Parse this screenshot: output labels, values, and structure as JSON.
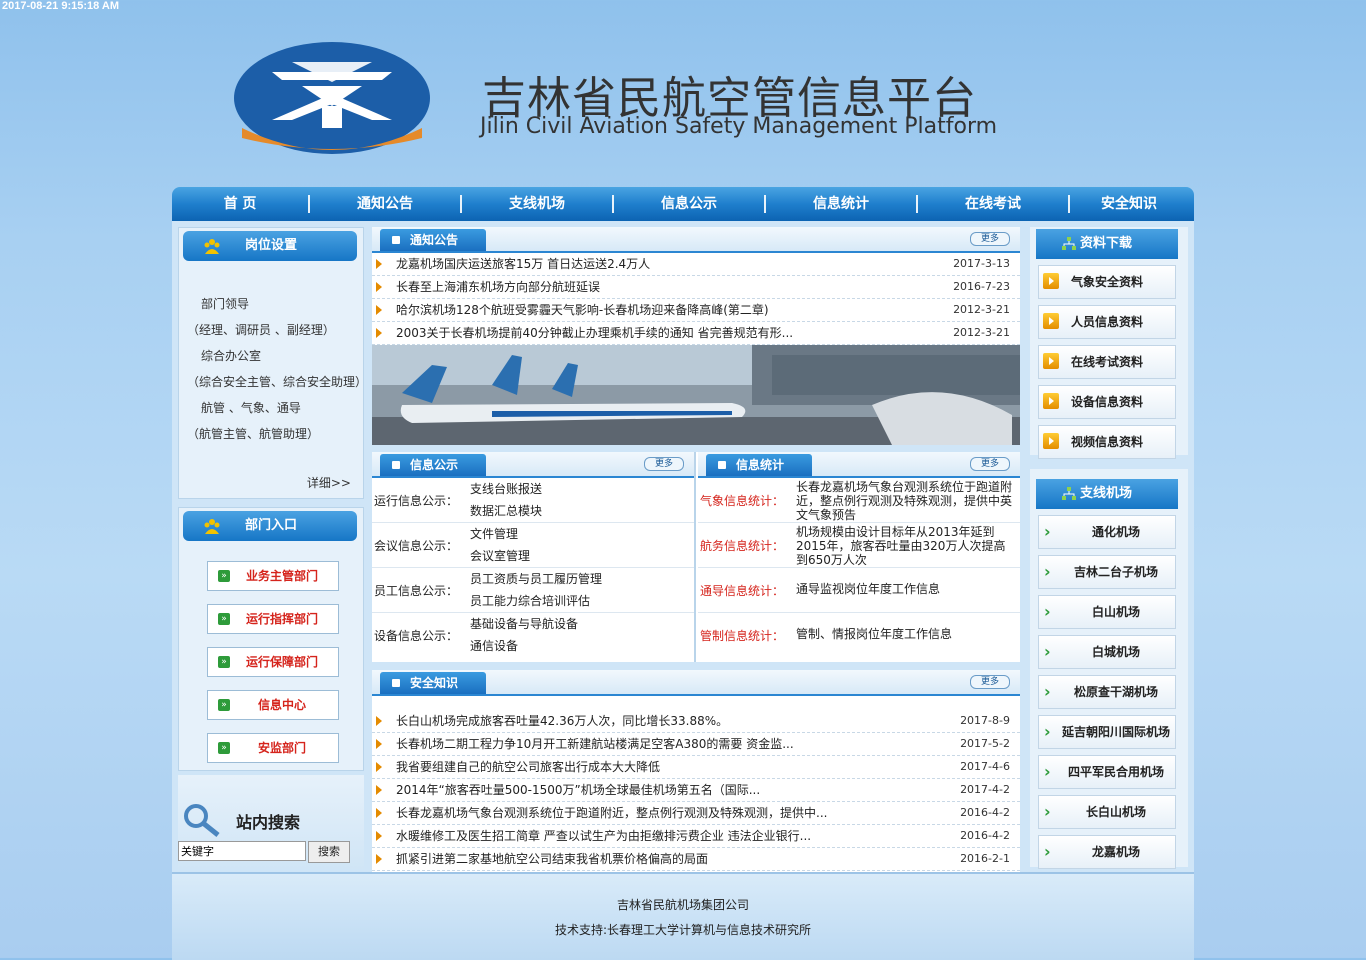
{
  "timestamp": "2017-08-21 9:15:18 AM",
  "header": {
    "title": "吉林省民航空管信息平台",
    "subtitle": "Jilin Civil Aviation Safety Management Platform"
  },
  "nav": [
    "首 页",
    "通知公告",
    "支线机场",
    "信息公示",
    "信息统计",
    "在线考试",
    "安全知识"
  ],
  "left": {
    "posts": {
      "title": "岗位设置",
      "lines": [
        "部门领导",
        "（经理、调研员 、副经理）",
        "综合办公室",
        "（综合安全主管、综合安全助理）",
        "航管 、气象、通导",
        "（航管主管、航管助理）"
      ],
      "more": "详细>>"
    },
    "dept": {
      "title": "部门入口",
      "buttons": [
        "业务主管部门",
        "运行指挥部门",
        "运行保障部门",
        "信息中心",
        "安监部门"
      ]
    },
    "search": {
      "title": "站内搜索",
      "value": "关键字",
      "button": "搜索"
    }
  },
  "notice": {
    "title": "通知公告",
    "more": "更多",
    "items": [
      {
        "title": "龙嘉机场国庆运送旅客15万 首日达运送2.4万人",
        "date": "2017-3-13"
      },
      {
        "title": "长春至上海浦东机场方向部分航班延误",
        "date": "2016-7-23"
      },
      {
        "title": "哈尔滨机场128个航班受雾霾天气影响-长春机场迎来备降高峰(第二章)",
        "date": "2012-3-21"
      },
      {
        "title": "2003关于长春机场提前40分钟截止办理乘机手续的通知 省完善规范有形...",
        "date": "2012-3-21"
      }
    ]
  },
  "info": {
    "title": "信息公示",
    "more": "更多",
    "rows": [
      {
        "cat": "运行信息公示：",
        "items": [
          "支线台账报送",
          "数据汇总模块"
        ]
      },
      {
        "cat": "会议信息公示：",
        "items": [
          "文件管理",
          "会议室管理"
        ]
      },
      {
        "cat": "员工信息公示：",
        "items": [
          "员工资质与员工履历管理",
          "员工能力综合培训评估"
        ]
      },
      {
        "cat": "设备信息公示：",
        "items": [
          "基础设备与导航设备",
          "通信设备"
        ]
      }
    ]
  },
  "stats": {
    "title": "信息统计",
    "more": "更多",
    "rows": [
      {
        "cat": "气象信息统计：",
        "text": "长春龙嘉机场气象台观测系统位于跑道附近，整点例行观测及特殊观测，提供中英文气象预告"
      },
      {
        "cat": "航务信息统计：",
        "text": "机场规模由设计目标年从2013年延到2015年，旅客吞吐量由320万人次提高到650万人次"
      },
      {
        "cat": "通导信息统计：",
        "text": "通导监视岗位年度工作信息"
      },
      {
        "cat": "管制信息统计：",
        "text": "管制、情报岗位年度工作信息"
      }
    ]
  },
  "safety": {
    "title": "安全知识",
    "more": "更多",
    "items": [
      {
        "title": "长白山机场完成旅客吞吐量42.36万人次，同比增长33.88%。",
        "date": "2017-8-9"
      },
      {
        "title": "长春机场二期工程力争10月开工新建航站楼满足空客A380的需要 资金监...",
        "date": "2017-5-2"
      },
      {
        "title": "我省要组建自己的航空公司旅客出行成本大大降低",
        "date": "2017-4-6"
      },
      {
        "title": "2014年“旅客吞吐量500-1500万”机场全球最佳机场第五名（国际...",
        "date": "2017-4-2"
      },
      {
        "title": "长春龙嘉机场气象台观测系统位于跑道附近，整点例行观测及特殊观测，提供中...",
        "date": "2016-4-2"
      },
      {
        "title": "水暖维修工及医生招工简章 严查以试生产为由拒缴排污费企业 违法企业银行...",
        "date": "2016-4-2"
      },
      {
        "title": "抓紧引进第二家基地航空公司结束我省机票价格偏高的局面",
        "date": "2016-2-1"
      }
    ]
  },
  "resources": {
    "title": "资料下载",
    "items": [
      "气象安全资料",
      "人员信息资料",
      "在线考试资料",
      "设备信息资料",
      "视频信息资料"
    ]
  },
  "airports": {
    "title": "支线机场",
    "items": [
      "通化机场",
      "吉林二台子机场",
      "白山机场",
      "白城机场",
      "松原查干湖机场",
      "延吉朝阳川国际机场",
      "四平军民合用机场",
      "长白山机场",
      "龙嘉机场"
    ]
  },
  "footer": {
    "line1": "吉林省民航机场集团公司",
    "line2": "技术支持:长春理工大学计算机与信息技术研究所"
  },
  "colors": {
    "nav_blue": "#1f7fcd",
    "accent_red": "#d5241c",
    "accent_orange": "#e48b00",
    "accent_green": "#2e9b3a"
  }
}
